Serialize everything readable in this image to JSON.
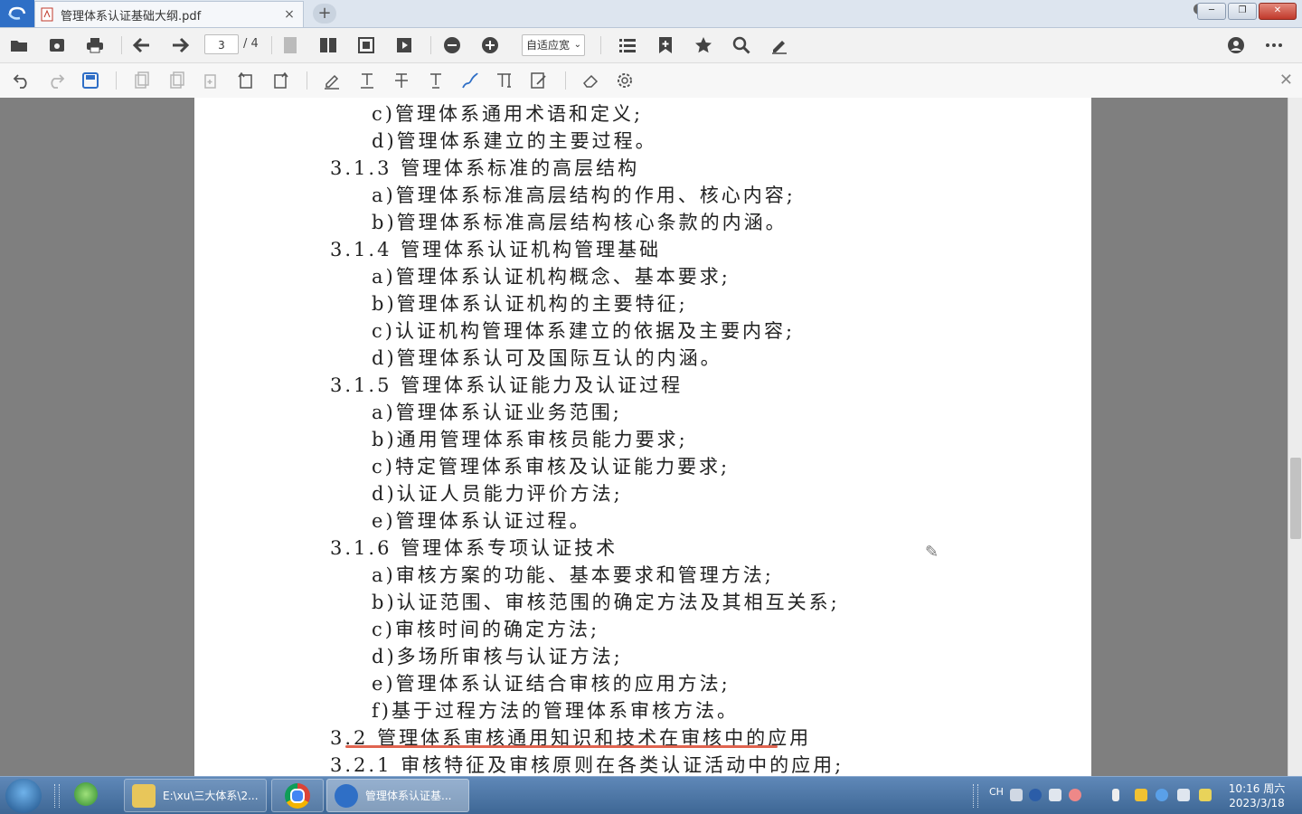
{
  "window": {
    "tab_title": "管理体系认证基础大纲.pdf",
    "tab_close": "×",
    "new_tab": "+",
    "min": "─",
    "max": "❐",
    "close": "✕"
  },
  "toolbar": {
    "page_current": "3",
    "page_total": "/ 4",
    "zoom_label": "自适应宽",
    "zoom_chevron": "⌄",
    "close": "✕"
  },
  "document": {
    "lines": [
      {
        "level": 2,
        "text": "c)管理体系通用术语和定义;"
      },
      {
        "level": 2,
        "text": "d)管理体系建立的主要过程。"
      },
      {
        "level": 1,
        "text": "3.1.3 管理体系标准的高层结构"
      },
      {
        "level": 2,
        "text": "a)管理体系标准高层结构的作用、核心内容;"
      },
      {
        "level": 2,
        "text": "b)管理体系标准高层结构核心条款的内涵。"
      },
      {
        "level": 1,
        "text": "3.1.4 管理体系认证机构管理基础"
      },
      {
        "level": 2,
        "text": "a)管理体系认证机构概念、基本要求;"
      },
      {
        "level": 2,
        "text": "b)管理体系认证机构的主要特征;"
      },
      {
        "level": 2,
        "text": "c)认证机构管理体系建立的依据及主要内容;"
      },
      {
        "level": 2,
        "text": "d)管理体系认可及国际互认的内涵。"
      },
      {
        "level": 1,
        "text": "3.1.5 管理体系认证能力及认证过程"
      },
      {
        "level": 2,
        "text": "a)管理体系认证业务范围;"
      },
      {
        "level": 2,
        "text": "b)通用管理体系审核员能力要求;"
      },
      {
        "level": 2,
        "text": "c)特定管理体系审核及认证能力要求;"
      },
      {
        "level": 2,
        "text": "d)认证人员能力评价方法;"
      },
      {
        "level": 2,
        "text": "e)管理体系认证过程。"
      },
      {
        "level": 1,
        "text": "3.1.6 管理体系专项认证技术"
      },
      {
        "level": 2,
        "text": "a)审核方案的功能、基本要求和管理方法;"
      },
      {
        "level": 2,
        "text": "b)认证范围、审核范围的确定方法及其相互关系;"
      },
      {
        "level": 2,
        "text": "c)审核时间的确定方法;"
      },
      {
        "level": 2,
        "text": "d)多场所审核与认证方法;"
      },
      {
        "level": 2,
        "text": "e)管理体系认证结合审核的应用方法;"
      },
      {
        "level": 2,
        "text": "f)基于过程方法的管理体系审核方法。"
      },
      {
        "level": 1,
        "text": "3.2 管理体系审核通用知识和技术在审核中的应用"
      },
      {
        "level": 1,
        "text": "3.2.1 审核特征及审核原则在各类认证活动中的应用;"
      }
    ]
  },
  "taskbar": {
    "items": [
      {
        "label": "E:\\xu\\三大体系\\2..."
      },
      {
        "label": ""
      },
      {
        "label": "管理体系认证基..."
      }
    ],
    "ime": "CH",
    "time": "10:16 周六",
    "date": "2023/3/18"
  },
  "colors": {
    "accent": "#2f6fc6",
    "underline": "#e06450"
  }
}
